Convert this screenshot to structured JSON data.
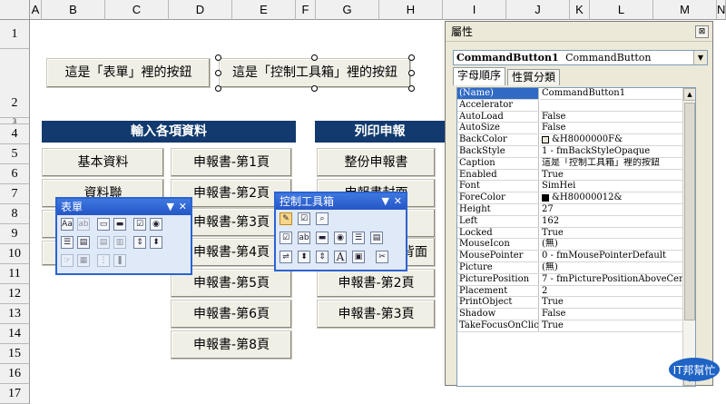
{
  "spreadsheet": {
    "columns": [
      "A",
      "B",
      "C",
      "D",
      "E",
      "F",
      "G",
      "H",
      "I",
      "J",
      "K",
      "L",
      "M",
      "N"
    ],
    "rows": [
      "1",
      "2",
      "3",
      "4",
      "5",
      "6",
      "7",
      "8",
      "9",
      "10",
      "11",
      "12",
      "13",
      "14",
      "15",
      "16",
      "17"
    ]
  },
  "top_buttons": {
    "form_button": "這是「表單」裡的按鈕",
    "control_button": "這是「控制工具箱」裡的按鈕"
  },
  "sections": {
    "input_header": "輸入各項資料",
    "print_header": "列印申報"
  },
  "input_buttons": [
    "基本資料",
    "資料聯"
  ],
  "page_buttons": [
    "申報書-第1頁",
    "申報書-第2頁",
    "申報書-第3頁",
    "申報書-第4頁",
    "申報書-第5頁",
    "申報書-第6頁",
    "申報書-第8頁"
  ],
  "print_buttons": [
    "整份申報書",
    "申報書封面",
    "申報書背面",
    "申報書-第2頁",
    "申報書-第3頁"
  ],
  "forms_toolbar": {
    "title": "表單",
    "icons": [
      "label-icon",
      "textbox-icon",
      "groupbox-icon",
      "button-icon",
      "checkbox-icon",
      "radio-icon",
      "listbox-icon",
      "combobox-icon",
      "combo-list-icon",
      "combo-drop-icon",
      "scrollbar-icon",
      "spinner-icon",
      "control-props-icon",
      "edit-code-icon",
      "grid-toggle-icon",
      "run-dialog-icon"
    ]
  },
  "control_toolbox": {
    "title": "控制工具箱",
    "icons": [
      "design-mode-icon",
      "properties-icon",
      "view-code-icon",
      "checkbox-icon",
      "textbox-icon",
      "command-button-icon",
      "option-button-icon",
      "listbox-icon",
      "combobox-icon",
      "toggle-icon",
      "spin-icon",
      "scrollbar-icon",
      "label-icon",
      "image-icon",
      "more-controls-icon"
    ]
  },
  "properties": {
    "title": "屬性",
    "object_name": "CommandButton1",
    "object_type": "CommandButton",
    "tabs": [
      "字母順序",
      "性質分類"
    ],
    "rows": [
      {
        "name": "(Name)",
        "value": "CommandButton1"
      },
      {
        "name": "Accelerator",
        "value": ""
      },
      {
        "name": "AutoLoad",
        "value": "False"
      },
      {
        "name": "AutoSize",
        "value": "False"
      },
      {
        "name": "BackColor",
        "value": "&H8000000F&",
        "swatch": "#ece9d8"
      },
      {
        "name": "BackStyle",
        "value": "1 - fmBackStyleOpaque"
      },
      {
        "name": "Caption",
        "value": "這是「控制工具箱」裡的按鈕"
      },
      {
        "name": "Enabled",
        "value": "True"
      },
      {
        "name": "Font",
        "value": "SimHei"
      },
      {
        "name": "ForeColor",
        "value": "&H80000012&",
        "swatch": "#000000"
      },
      {
        "name": "Height",
        "value": "27"
      },
      {
        "name": "Left",
        "value": "162"
      },
      {
        "name": "Locked",
        "value": "True"
      },
      {
        "name": "MouseIcon",
        "value": "(無)"
      },
      {
        "name": "MousePointer",
        "value": "0 - fmMousePointerDefault"
      },
      {
        "name": "Picture",
        "value": "(無)"
      },
      {
        "name": "PicturePosition",
        "value": "7 - fmPicturePositionAboveCenter"
      },
      {
        "name": "Placement",
        "value": "2"
      },
      {
        "name": "PrintObject",
        "value": "True"
      },
      {
        "name": "Shadow",
        "value": "False"
      },
      {
        "name": "TakeFocusOnClick",
        "value": "True"
      }
    ]
  },
  "watermark": "IT邦幫忙",
  "colors": {
    "band": "#123a6e",
    "toolbar_title": "#2b63d1",
    "selection": "#316ac5"
  }
}
